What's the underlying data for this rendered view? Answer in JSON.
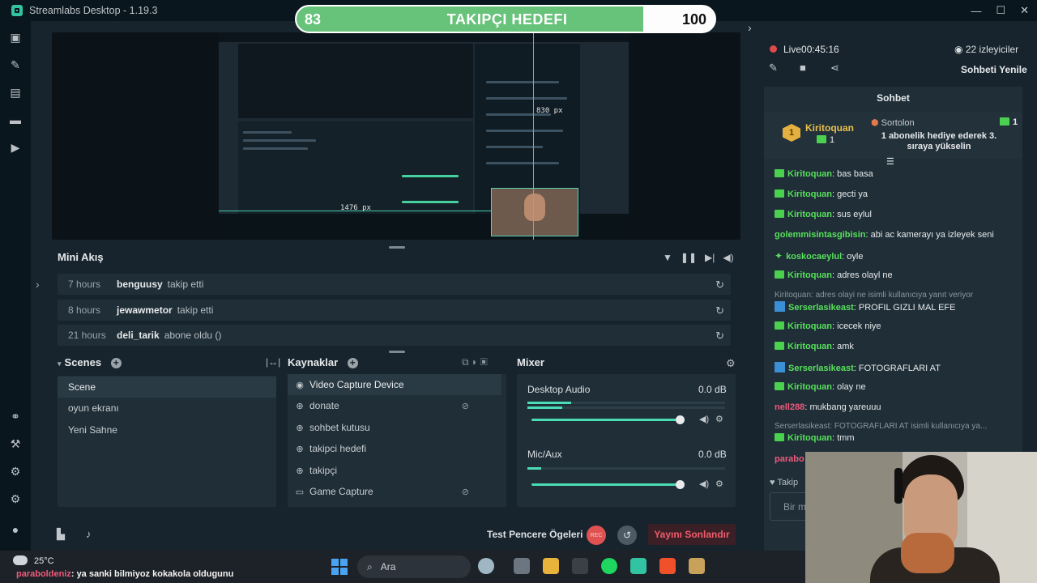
{
  "window": {
    "title": "Streamlabs Desktop - 1.19.3",
    "controls": [
      "—",
      "☐",
      "✕"
    ]
  },
  "goal": {
    "start": "83",
    "title": "TAKIPÇI HEDEFI",
    "end": "100",
    "progress": 0.83
  },
  "preview": {
    "measure_width": "830 px",
    "measure_height": "1476 px"
  },
  "mini_feed": {
    "title": "Mini Akış",
    "rows": [
      {
        "time": "7 hours",
        "user": "benguusy",
        "action": "takip etti"
      },
      {
        "time": "8 hours",
        "user": "jewawmetor",
        "action": "takip etti"
      },
      {
        "time": "21 hours",
        "user": "deli_tarik",
        "action": "abone oldu ()"
      }
    ]
  },
  "scenes": {
    "title": "Scenes",
    "items": [
      "Scene",
      "oyun ekranı",
      "Yeni Sahne"
    ],
    "active_index": 0
  },
  "sources": {
    "title": "Kaynaklar",
    "items": [
      {
        "label": "Video Capture Device",
        "icon": "webcam-icon",
        "hidden": false
      },
      {
        "label": "donate",
        "icon": "globe-icon",
        "hidden": true
      },
      {
        "label": "sohbet kutusu",
        "icon": "globe-icon",
        "hidden": false
      },
      {
        "label": "takipci hedefi",
        "icon": "globe-icon",
        "hidden": false
      },
      {
        "label": "takipçi",
        "icon": "globe-icon",
        "hidden": false
      },
      {
        "label": "Game Capture",
        "icon": "gamepad-icon",
        "hidden": true
      }
    ]
  },
  "mixer": {
    "title": "Mixer",
    "channels": [
      {
        "name": "Desktop Audio",
        "db": "0.0 dB",
        "level": 0.22
      },
      {
        "name": "Mic/Aux",
        "db": "0.0 dB",
        "level": 0.07
      }
    ]
  },
  "controls": {
    "test_label": "Test Pencere Ögeleri",
    "rec_label": "REC",
    "end_stream_label": "Yayını Sonlandır"
  },
  "stream": {
    "live_label": "Live",
    "live_time": "00:45:16",
    "viewers": "22 izleyiciler",
    "refresh_chat": "Sohbeti Yenile"
  },
  "chat": {
    "title": "Sohbet",
    "pinned": {
      "badge": "1",
      "user1": "Kiritoquan",
      "count1": "1",
      "user2": "Sortolon",
      "count2": "1",
      "message": "1 abonelik hediye ederek 3. sıraya yükselin"
    },
    "messages": [
      {
        "user": "Kiritoquan",
        "text": "bas basa",
        "color": "#58e05c",
        "badge": "green"
      },
      {
        "user": "Kiritoquan",
        "text": "gecti ya",
        "color": "#58e05c",
        "badge": "green"
      },
      {
        "user": "Kiritoquan",
        "text": "sus eylul",
        "color": "#58e05c",
        "badge": "green"
      },
      {
        "user": "golemmisintasgibisin",
        "text": "abi ac kamerayı ya izleyek seni",
        "color": "#58e05c",
        "badge": "none"
      },
      {
        "user": "koskocaeylul",
        "text": "oyle",
        "color": "#58e05c",
        "badge": "star"
      },
      {
        "user": "Kiritoquan",
        "text": "adres olayl ne",
        "color": "#58e05c",
        "badge": "green"
      },
      {
        "user": "Serserlasikeast",
        "text": "PROFIL GIZLI MAL EFE",
        "color": "#58e05c",
        "badge": "blue"
      },
      {
        "user": "Kiritoquan",
        "text": "icecek niye",
        "color": "#58e05c",
        "badge": "green"
      },
      {
        "user": "Kiritoquan",
        "text": "amk",
        "color": "#58e05c",
        "badge": "green"
      },
      {
        "user": "Serserlasikeast",
        "text": "FOTOGRAFLARI AT",
        "color": "#58e05c",
        "badge": "blue"
      },
      {
        "user": "Kiritoquan",
        "text": "olay ne",
        "color": "#58e05c",
        "badge": "green"
      },
      {
        "user": "nell288",
        "text": "mukbang yareuuu",
        "color": "#ef5a7c",
        "badge": "none"
      },
      {
        "user": "Kiritoquan",
        "text": "tmm",
        "color": "#58e05c",
        "badge": "green"
      },
      {
        "user": "parabo",
        "text": "",
        "color": "#ef5a7c",
        "badge": "none"
      }
    ],
    "replies": [
      "Kiritoquan: adres olayi ne isimli kullanıcıya yanıt veriyor",
      "Serserlasikeast: FOTOGRAFLARI AT isimli kullanıcıya ya..."
    ],
    "follow_prefix": "Takip",
    "input_placeholder": "Bir m"
  },
  "taskbar": {
    "temperature": "25°C",
    "search": "Ara",
    "overlay_user": "paraboldeniz",
    "overlay_text": ": ya sanki bilmiyoz kokakola oldugunu"
  }
}
